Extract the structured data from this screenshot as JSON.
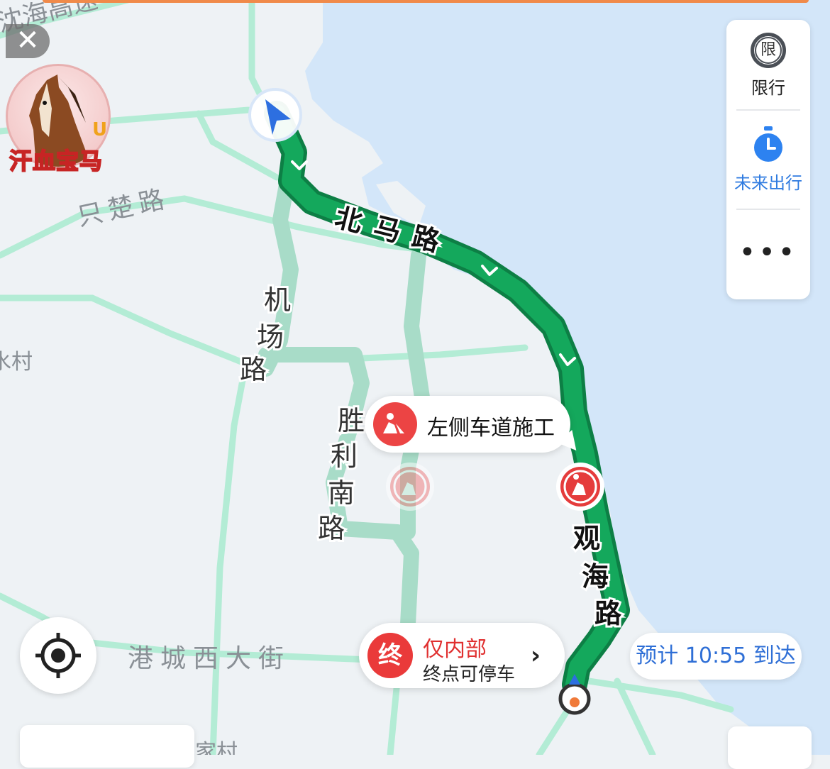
{
  "map": {
    "roads": {
      "highway": "沈海高速",
      "zhichu": "只楚路",
      "beima": "北马路",
      "jichang": [
        "机",
        "场",
        "路"
      ],
      "shengli": [
        "胜",
        "利",
        "南",
        "路"
      ],
      "guanhai": [
        "观",
        "海",
        "路"
      ],
      "gangcheng": "港城西大街"
    },
    "places": {
      "village_left": "水村",
      "village_bottom": "家村"
    }
  },
  "close_button": {
    "label": "✕"
  },
  "badge": {
    "text": "汗血宝马",
    "accent": "U"
  },
  "side_panel": {
    "restriction": {
      "icon_char": "限",
      "label": "限行"
    },
    "future_trip": {
      "label": "未来出行"
    },
    "more": {
      "label": "•••"
    }
  },
  "alert_bubble": {
    "text": "左侧车道施工"
  },
  "destination": {
    "icon_char": "终",
    "title": "仅内部",
    "subtitle": "终点可停车",
    "arrow": "›"
  },
  "eta": {
    "text": "预计 10:55 到达"
  },
  "colors": {
    "route": "#14a85c",
    "route_border": "#0d7f45",
    "water": "#d3e6f9",
    "land": "#eef2f5",
    "roads": "#a8e8cf",
    "alert": "#ec4444",
    "eta_text": "#2f6fd6"
  },
  "icons": {
    "nav_arrow": "navigation-arrow-icon",
    "construction": "construction-icon",
    "locate": "locate-icon",
    "clock": "stopwatch-icon",
    "end_pin": "destination-pin-icon"
  }
}
